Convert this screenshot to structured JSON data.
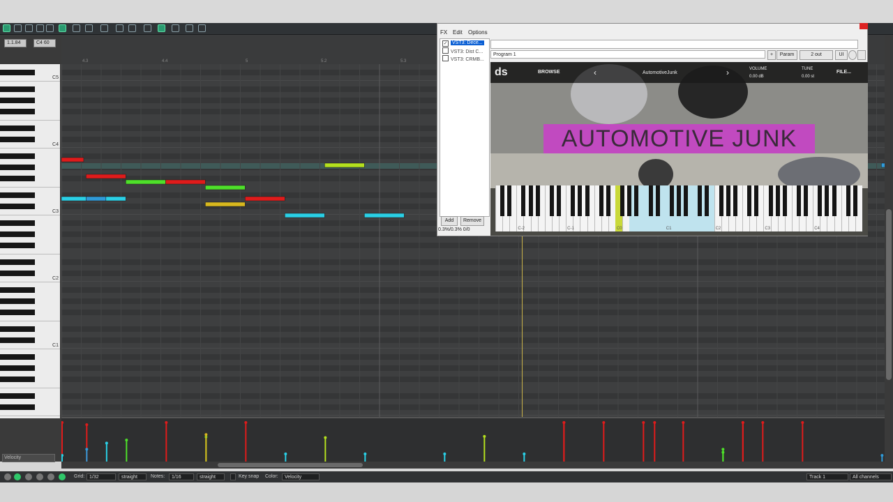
{
  "toolbar": {
    "position_display": "1.1.84",
    "note_display": "C4 60"
  },
  "keyboard": {
    "octave_labels": [
      "C5",
      "C4",
      "C3",
      "C2",
      "C1"
    ]
  },
  "ruler": {
    "labels": [
      "4.3",
      "4.4",
      "5",
      "5.2",
      "5.3"
    ]
  },
  "velocity_lane": {
    "label": "Velocity"
  },
  "statusbar": {
    "grid_label": "Grid:",
    "grid_value": "1/32",
    "grid_mode": "straight",
    "notes_label": "Notes:",
    "notes_value": "1/16",
    "notes_mode": "straight",
    "key_snap_label": "Key snap",
    "color_label": "Color:",
    "color_value": "Velocity",
    "track_value": "Track 1",
    "channel_value": "All channels"
  },
  "fx_window": {
    "menu": [
      "FX",
      "Edit",
      "Options"
    ],
    "chain": [
      {
        "name": "VST3: Dece...",
        "checked": true,
        "selected": true
      },
      {
        "name": "VST3: Dist C...",
        "checked": false,
        "selected": false
      },
      {
        "name": "VST3: CRMB...",
        "checked": false,
        "selected": false
      }
    ],
    "add_button": "Add",
    "remove_button": "Remove",
    "cpu_text": "0.3%/0.3% 0/0",
    "preset_value": "Program 1",
    "plus_button": "+",
    "param_button": "Param",
    "out_button": "2 out",
    "ui_button": "UI"
  },
  "plugin": {
    "logo": "ds",
    "browse_label": "BROWSE",
    "preset_name": "AutomotiveJunk",
    "volume_label": "VOLUME",
    "volume_value": "0.00 dB",
    "tune_label": "TUNE",
    "tune_value": "0.00 st",
    "file_label": "FILE...",
    "title": "AUTOMOTIVE JUNK",
    "keyboard_labels": [
      "C-2",
      "C-1",
      "C0",
      "C1",
      "C2",
      "C3",
      "C4"
    ]
  },
  "colors": {
    "note_red": "#e01b1b",
    "note_green": "#4ee02a",
    "note_lime": "#b4e01e",
    "note_cyan": "#2ad0e6",
    "note_blue": "#2f9ad8",
    "note_yellow": "#d8b81e",
    "selection_accent": "#0a5fd4",
    "plugin_title_bg": "#c14ac0"
  },
  "notes": [
    {
      "start": 0.0,
      "length": 0.56,
      "pitch": 58,
      "velocity": 127,
      "color": "red"
    },
    {
      "start": 0.62,
      "length": 1.0,
      "pitch": 55,
      "velocity": 120,
      "color": "red"
    },
    {
      "start": 0.0,
      "length": 0.62,
      "pitch": 51,
      "velocity": 20,
      "color": "cyan"
    },
    {
      "start": 0.62,
      "length": 0.5,
      "pitch": 51,
      "velocity": 40,
      "color": "blue"
    },
    {
      "start": 1.12,
      "length": 0.5,
      "pitch": 51,
      "velocity": 60,
      "color": "cyan"
    },
    {
      "start": 1.62,
      "length": 1.0,
      "pitch": 54,
      "velocity": 70,
      "color": "green"
    },
    {
      "start": 2.62,
      "length": 1.0,
      "pitch": 54,
      "velocity": 127,
      "color": "red"
    },
    {
      "start": 3.62,
      "length": 1.0,
      "pitch": 53,
      "velocity": 80,
      "color": "green"
    },
    {
      "start": 3.62,
      "length": 1.0,
      "pitch": 50,
      "velocity": 88,
      "color": "yellow"
    },
    {
      "start": 4.62,
      "length": 1.0,
      "pitch": 51,
      "velocity": 127,
      "color": "red"
    },
    {
      "start": 5.62,
      "length": 1.0,
      "pitch": 48,
      "velocity": 25,
      "color": "cyan"
    },
    {
      "start": 6.62,
      "length": 1.0,
      "pitch": 57,
      "velocity": 78,
      "color": "lime"
    },
    {
      "start": 7.62,
      "length": 1.0,
      "pitch": 48,
      "velocity": 25,
      "color": "cyan"
    },
    {
      "start": 9.62,
      "length": 1.0,
      "pitch": 48,
      "velocity": 25,
      "color": "cyan"
    },
    {
      "start": 10.62,
      "length": 1.0,
      "pitch": 57,
      "velocity": 82,
      "color": "lime"
    },
    {
      "start": 11.62,
      "length": 1.0,
      "pitch": 48,
      "velocity": 25,
      "color": "cyan"
    },
    {
      "start": 12.62,
      "length": 1.0,
      "pitch": 54,
      "velocity": 127,
      "color": "red"
    },
    {
      "start": 12.62,
      "length": 1.0,
      "pitch": 53,
      "velocity": 127,
      "color": "red"
    },
    {
      "start": 13.62,
      "length": 1.0,
      "pitch": 56,
      "velocity": 127,
      "color": "red"
    },
    {
      "start": 14.62,
      "length": 1.0,
      "pitch": 59,
      "velocity": 127,
      "color": "red"
    },
    {
      "start": 14.9,
      "length": 1.0,
      "pitch": 57,
      "velocity": 127,
      "color": "red"
    },
    {
      "start": 15.62,
      "length": 1.0,
      "pitch": 56,
      "velocity": 127,
      "color": "red"
    },
    {
      "start": 16.62,
      "length": 1.0,
      "pitch": 55,
      "velocity": 30,
      "color": "green"
    },
    {
      "start": 16.62,
      "length": 0.5,
      "pitch": 53,
      "velocity": 40,
      "color": "green"
    },
    {
      "start": 17.12,
      "length": 1.0,
      "pitch": 54,
      "velocity": 127,
      "color": "red"
    },
    {
      "start": 17.12,
      "length": 1.0,
      "pitch": 53,
      "velocity": 127,
      "color": "red"
    },
    {
      "start": 17.62,
      "length": 1.0,
      "pitch": 55,
      "velocity": 127,
      "color": "red"
    },
    {
      "start": 18.62,
      "length": 1.0,
      "pitch": 57,
      "velocity": 127,
      "color": "red"
    },
    {
      "start": 20.62,
      "length": 0.2,
      "pitch": 57,
      "velocity": 20,
      "color": "blue"
    }
  ]
}
